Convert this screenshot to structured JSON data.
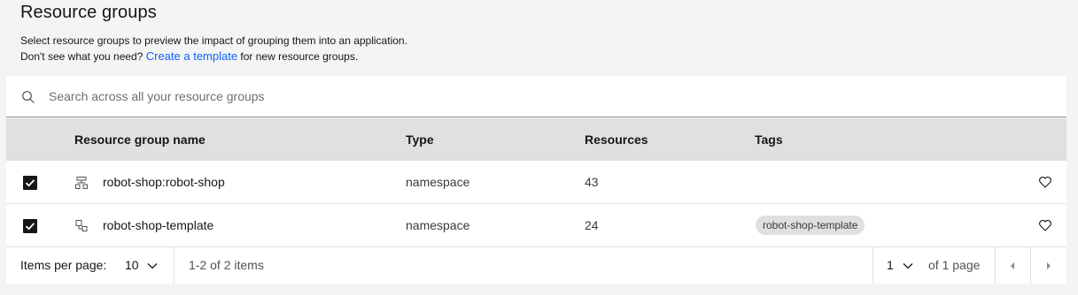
{
  "header": {
    "title": "Resource groups",
    "desc_line1": "Select resource groups to preview the impact of grouping them into an application.",
    "desc_line2_prefix": "Don't see what you need?",
    "desc_link": "Create a template",
    "desc_line2_suffix": "for new resource groups."
  },
  "search": {
    "placeholder": "Search across all your resource groups",
    "icon": "search-icon"
  },
  "table": {
    "columns": [
      "Resource group name",
      "Type",
      "Resources",
      "Tags"
    ],
    "rows": [
      {
        "selected": true,
        "icon": "cluster-icon",
        "name": "robot-shop:robot-shop",
        "type": "namespace",
        "resources": "43",
        "tag": ""
      },
      {
        "selected": true,
        "icon": "template-icon",
        "name": "robot-shop-template",
        "type": "namespace",
        "resources": "24",
        "tag": "robot-shop-template"
      }
    ]
  },
  "pagination": {
    "items_per_page_label": "Items per page:",
    "items_per_page_value": "10",
    "range_text": "1-2 of 2 items",
    "page_value": "1",
    "page_total_text": "of 1 page"
  }
}
